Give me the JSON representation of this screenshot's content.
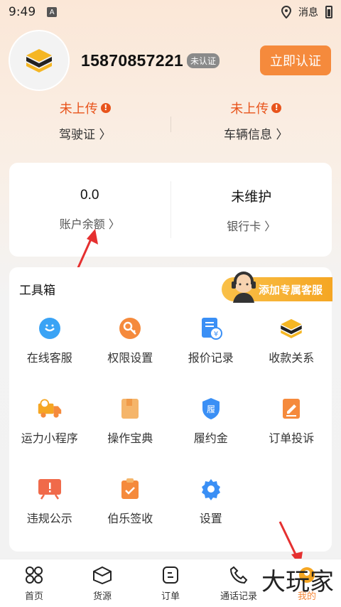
{
  "status_bar": {
    "time": "9:49",
    "network": "消息"
  },
  "profile": {
    "phone": "15870857221",
    "badge": "未认证",
    "verify_button": "立即认证"
  },
  "documents": [
    {
      "status": "未上传",
      "label": "驾驶证 〉"
    },
    {
      "status": "未上传",
      "label": "车辆信息 〉"
    }
  ],
  "balance_card": {
    "balance_value": "0.0",
    "balance_label": "账户余额 〉",
    "bank_value": "未维护",
    "bank_label": "银行卡 〉"
  },
  "toolbox": {
    "title": "工具箱",
    "cs_banner": "添加专属客服",
    "tools": [
      {
        "label": "在线客服",
        "icon": "chat-bubble-icon",
        "color": "#3aa3f5"
      },
      {
        "label": "权限设置",
        "icon": "key-gear-icon",
        "color": "#f58a3c"
      },
      {
        "label": "报价记录",
        "icon": "quote-receipt-icon",
        "color": "#3a8ff5"
      },
      {
        "label": "收款关系",
        "icon": "logo-stack-icon",
        "color": "#f5b623"
      },
      {
        "label": "运力小程序",
        "icon": "truck-icon",
        "color": "#f5a623"
      },
      {
        "label": "操作宝典",
        "icon": "book-icon",
        "color": "#f5b56a"
      },
      {
        "label": "履约金",
        "icon": "shield-deposit-icon",
        "color": "#3a8ff5"
      },
      {
        "label": "订单投诉",
        "icon": "pen-edit-icon",
        "color": "#f58a3c"
      },
      {
        "label": "违规公示",
        "icon": "warning-board-icon",
        "color": "#f06a4a"
      },
      {
        "label": "伯乐签收",
        "icon": "clipboard-check-icon",
        "color": "#f58a3c"
      },
      {
        "label": "设置",
        "icon": "gear-icon",
        "color": "#3a8ff5"
      }
    ]
  },
  "tabbar": [
    {
      "label": "首页",
      "icon": "grid-home-icon"
    },
    {
      "label": "货源",
      "icon": "box-cargo-icon"
    },
    {
      "label": "订单",
      "icon": "order-list-icon"
    },
    {
      "label": "通话记录",
      "icon": "phone-icon"
    },
    {
      "label": "我的",
      "icon": "profile-icon"
    }
  ],
  "watermark": "大玩家",
  "colors": {
    "accent": "#f58a3c",
    "warning": "#e8541c"
  }
}
